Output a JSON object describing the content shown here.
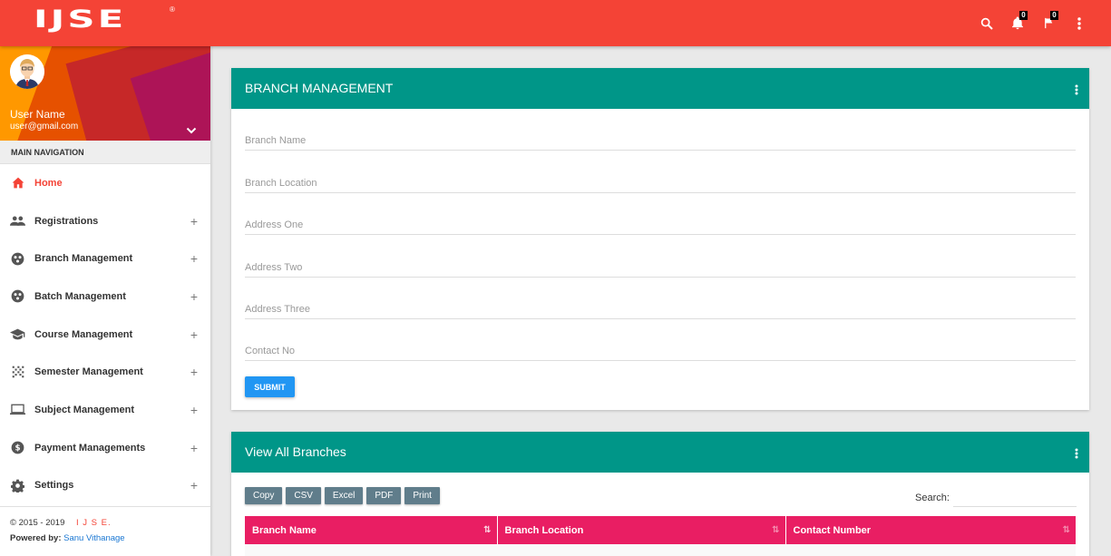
{
  "app": {
    "logo": "IJSE",
    "logo_mark": "®"
  },
  "topbar": {
    "notifications_count": "0",
    "flags_count": "0"
  },
  "user": {
    "name": "User Name",
    "email": "user@gmail.com"
  },
  "sidebar": {
    "header": "MAIN NAVIGATION",
    "items": [
      {
        "label": "Home",
        "icon": "home-icon",
        "expandable": false,
        "active": true
      },
      {
        "label": "Registrations",
        "icon": "people-icon",
        "expandable": true
      },
      {
        "label": "Branch Management",
        "icon": "branch-icon",
        "expandable": true
      },
      {
        "label": "Batch Management",
        "icon": "batch-icon",
        "expandable": true
      },
      {
        "label": "Course Management",
        "icon": "graduation-cap-icon",
        "expandable": true
      },
      {
        "label": "Semester Management",
        "icon": "grid-dots-icon",
        "expandable": true
      },
      {
        "label": "Subject Management",
        "icon": "laptop-icon",
        "expandable": true
      },
      {
        "label": "Payment Managements",
        "icon": "dollar-icon",
        "expandable": true
      },
      {
        "label": "Settings",
        "icon": "gear-icon",
        "expandable": true
      }
    ],
    "plus": "+",
    "footer": {
      "copyright": "© 2015 - 2019",
      "brand": "I J S E.",
      "powered_label": "Powered by:",
      "author": "Sanu Vithanage"
    }
  },
  "branch_form": {
    "title": "BRANCH MANAGEMENT",
    "fields": [
      {
        "placeholder": "Branch Name",
        "value": ""
      },
      {
        "placeholder": "Branch Location",
        "value": ""
      },
      {
        "placeholder": "Address One",
        "value": ""
      },
      {
        "placeholder": "Address Two",
        "value": ""
      },
      {
        "placeholder": "Address Three",
        "value": ""
      },
      {
        "placeholder": "Contact No",
        "value": ""
      }
    ],
    "submit_label": "SUBMIT"
  },
  "branches_table": {
    "title": "View All Branches",
    "export_buttons": [
      "Copy",
      "CSV",
      "Excel",
      "PDF",
      "Print"
    ],
    "search_label": "Search:",
    "search_value": "",
    "columns": [
      "Branch Name",
      "Branch Location",
      "Contact Number"
    ]
  },
  "colors": {
    "topbar": "#f44336",
    "card_header": "#009688",
    "table_header": "#e91e63",
    "submit": "#2196f3",
    "export_button": "#607d8b"
  }
}
